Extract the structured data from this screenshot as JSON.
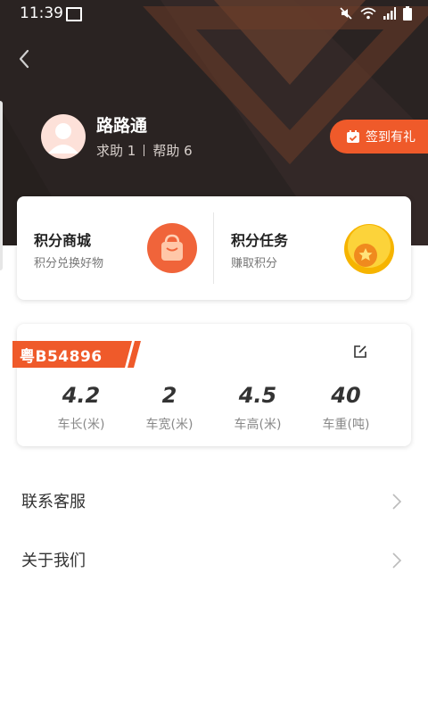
{
  "status": {
    "time": "11:39"
  },
  "profile": {
    "name": "路路通",
    "seek_help_label": "求助",
    "seek_help_count": "1",
    "help_label": "帮助",
    "help_count": "6"
  },
  "checkin": {
    "label": "签到有礼"
  },
  "points": {
    "mall": {
      "title": "积分商城",
      "subtitle": "积分兑换好物",
      "icon": "shopping-bag-icon"
    },
    "tasks": {
      "title": "积分任务",
      "subtitle": "赚取积分",
      "icon": "star-coin-icon"
    }
  },
  "vehicle": {
    "plate": "粤B54896",
    "specs": [
      {
        "value": "4.2",
        "label": "车长(米)"
      },
      {
        "value": "2",
        "label": "车宽(米)"
      },
      {
        "value": "4.5",
        "label": "车高(米)"
      },
      {
        "value": "40",
        "label": "车重(吨)"
      }
    ]
  },
  "menu": [
    {
      "label": "联系客服"
    },
    {
      "label": "关于我们"
    }
  ],
  "colors": {
    "accent": "#ef5a2a",
    "header_bg": "#2a2322"
  }
}
